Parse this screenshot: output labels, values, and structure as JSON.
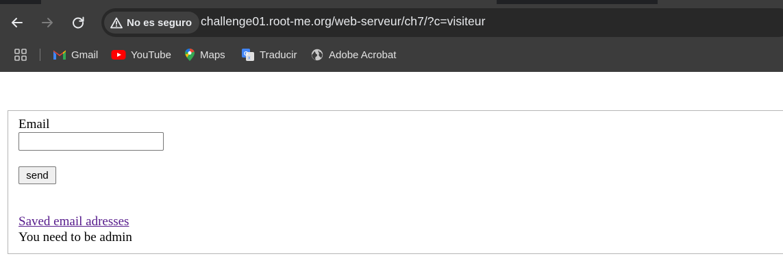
{
  "browser": {
    "security_label": "No es seguro",
    "url": "challenge01.root-me.org/web-serveur/ch7/?c=visiteur",
    "bookmarks": [
      {
        "label": "Gmail",
        "icon": "gmail-icon"
      },
      {
        "label": "YouTube",
        "icon": "youtube-icon"
      },
      {
        "label": "Maps",
        "icon": "maps-icon"
      },
      {
        "label": "Traducir",
        "icon": "translate-icon"
      },
      {
        "label": "Adobe Acrobat",
        "icon": "globe-icon"
      }
    ],
    "colors": {
      "toolbar": "#3c3c3c",
      "omnibox": "#282828",
      "text": "#e8eaed"
    }
  },
  "page": {
    "email_label": "Email",
    "email_value": "",
    "send_label": "send",
    "saved_link": "Saved email adresses",
    "admin_message": "You need to be admin",
    "colors": {
      "visited_link": "#551a8b",
      "border": "#b5b5b5"
    }
  }
}
